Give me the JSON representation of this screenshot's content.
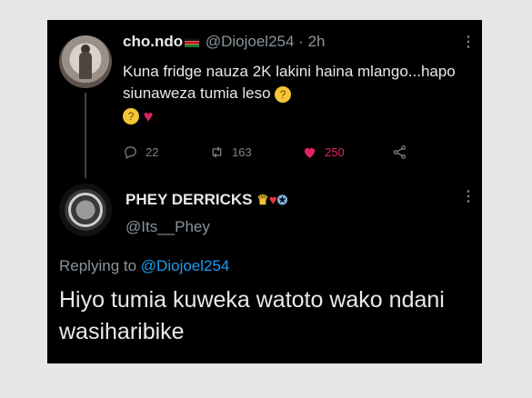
{
  "tweet": {
    "display_name": "cho.ndo",
    "flag_icon": "kenya-flag-icon",
    "handle": "@Diojoel254",
    "separator": "·",
    "time": "2h",
    "text": "Kuna fridge nauza 2K lakini haina mlango...hapo  siunaweza tumia leso",
    "reply_count": "22",
    "retweet_count": "163",
    "like_count": "250",
    "like_color": "#e0245e"
  },
  "reply": {
    "display_name": "PHEY DERRICKS",
    "handle": "@Its__Phey",
    "replying_prefix": "Replying to",
    "replying_to": "@Diojoel254",
    "text": "Hiyo tumia kuweka watoto wako ndani wasiharibike",
    "mention_color": "#1d9bf0"
  }
}
